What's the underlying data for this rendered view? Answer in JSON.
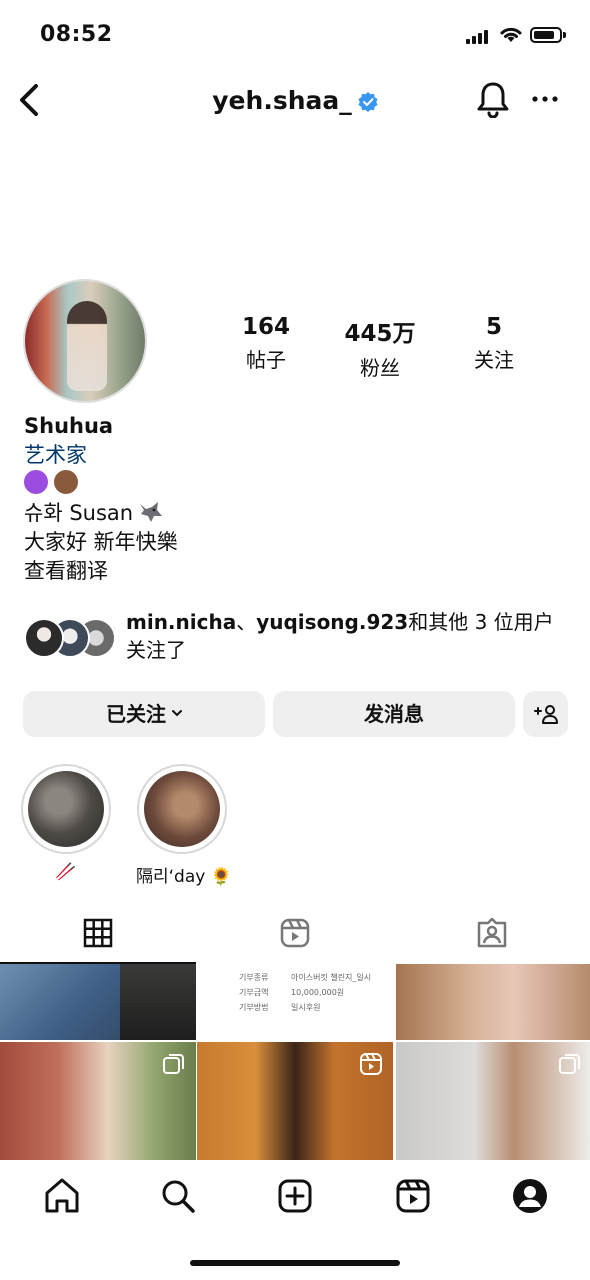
{
  "status_bar": {
    "time": "08:52",
    "battery_level": 0.85
  },
  "header": {
    "username": "yeh.shaa_",
    "verified": true,
    "icons": [
      "back-arrow-icon",
      "verified-badge-icon",
      "bell-icon",
      "more-icon"
    ]
  },
  "profile": {
    "stats": [
      {
        "value": "164",
        "label": "帖子"
      },
      {
        "value": "445万",
        "label": "粉丝"
      },
      {
        "value": "5",
        "label": "关注"
      }
    ],
    "name": "Shuhua",
    "category": "艺术家",
    "bio_hearts": [
      "purple-heart",
      "brown-heart"
    ],
    "bio_lines": [
      "슈화 Susan",
      "大家好 新年快樂"
    ],
    "translate": "查看翻译",
    "colors": {
      "category": "#00376b",
      "purple_heart": "#9b4de0",
      "brown_heart": "#8a5a3c"
    }
  },
  "followed_by": {
    "user1": "min.nicha",
    "separator": "、",
    "user2": "yuqisong.923",
    "suffix": "和其他 3 位用户关注了"
  },
  "actions": {
    "following_label": "已关注",
    "message_label": "发消息",
    "add_user_icon": "add-person-icon"
  },
  "highlights": [
    {
      "label": "🥢"
    },
    {
      "label": "隔리‘day 🌻"
    }
  ],
  "tabs": [
    {
      "name": "posts",
      "icon": "grid-icon",
      "active": true
    },
    {
      "name": "reels",
      "icon": "reels-icon",
      "active": false
    },
    {
      "name": "tagged",
      "icon": "tagged-icon",
      "active": false
    }
  ],
  "grid_doc": [
    {
      "k": "기부종류",
      "v": "아이스버킷 챌린지_일시"
    },
    {
      "k": "기부금액",
      "v": "10,000,000원"
    },
    {
      "k": "기부방법",
      "v": "일시후원"
    }
  ],
  "bottom_nav": [
    "home-icon",
    "search-icon",
    "create-icon",
    "reels-icon",
    "profile-icon"
  ]
}
